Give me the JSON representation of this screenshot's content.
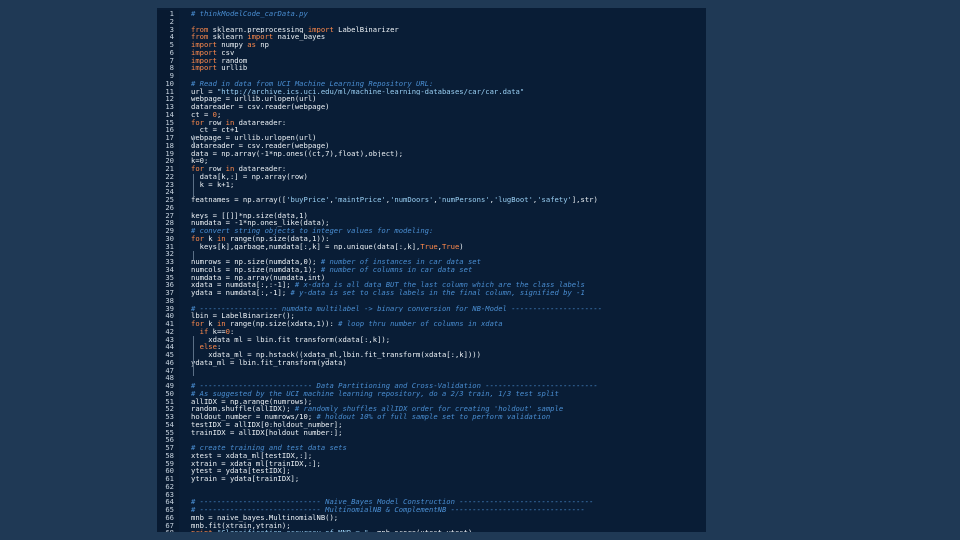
{
  "editor": {
    "colors": {
      "page": "#1f3955",
      "editor": "#091d36",
      "keyword": "#ff8a4c",
      "comment": "#4a8ed2",
      "string": "#9ad0f4",
      "default": "#eef3f7",
      "line_number": "#c7d3df"
    },
    "lines": [
      [
        {
          "t": "cm",
          "s": "# thinkModelCode_carData.py"
        }
      ],
      [],
      [
        {
          "t": "kw",
          "s": "from"
        },
        {
          "t": "df",
          "s": " sklearn.preprocessing "
        },
        {
          "t": "kw",
          "s": "import"
        },
        {
          "t": "df",
          "s": " LabelBinarizer"
        }
      ],
      [
        {
          "t": "kw",
          "s": "from"
        },
        {
          "t": "df",
          "s": " sklearn "
        },
        {
          "t": "kw",
          "s": "import"
        },
        {
          "t": "df",
          "s": " naive_bayes"
        }
      ],
      [
        {
          "t": "kw",
          "s": "import"
        },
        {
          "t": "df",
          "s": " numpy "
        },
        {
          "t": "kw",
          "s": "as"
        },
        {
          "t": "df",
          "s": " np"
        }
      ],
      [
        {
          "t": "kw",
          "s": "import"
        },
        {
          "t": "df",
          "s": " csv"
        }
      ],
      [
        {
          "t": "kw",
          "s": "import"
        },
        {
          "t": "df",
          "s": " random"
        }
      ],
      [
        {
          "t": "kw",
          "s": "import"
        },
        {
          "t": "df",
          "s": " urllib"
        }
      ],
      [],
      [
        {
          "t": "cm",
          "s": "# Read in data from UCI Machine Learning Repository URL:"
        }
      ],
      [
        {
          "t": "df",
          "s": "url = "
        },
        {
          "t": "st",
          "s": "\"http://archive.ics.uci.edu/ml/machine-learning-databases/car/car.data\""
        }
      ],
      [
        {
          "t": "df",
          "s": "webpage = urllib.urlopen(url)"
        }
      ],
      [
        {
          "t": "df",
          "s": "datareader = csv.reader(webpage)"
        }
      ],
      [
        {
          "t": "df",
          "s": "ct = "
        },
        {
          "t": "kw",
          "s": "0"
        },
        {
          "t": "df",
          "s": ";"
        }
      ],
      [
        {
          "t": "kw",
          "s": "for"
        },
        {
          "t": "df",
          "s": " row "
        },
        {
          "t": "kw",
          "s": "in"
        },
        {
          "t": "df",
          "s": " datareader:"
        }
      ],
      [
        {
          "t": "df",
          "s": "  ct = ct+1"
        }
      ],
      [
        {
          "t": "df",
          "s": "webpage = urllib.urlopen(url)"
        }
      ],
      [
        {
          "t": "df",
          "s": "datareader = csv.reader(webpage)"
        }
      ],
      [
        {
          "t": "df",
          "s": "data = np.array(-1*np.ones((ct,7),float),object);"
        }
      ],
      [
        {
          "t": "df",
          "s": "k=0;"
        }
      ],
      [
        {
          "t": "kw",
          "s": "for"
        },
        {
          "t": "df",
          "s": " row "
        },
        {
          "t": "kw",
          "s": "in"
        },
        {
          "t": "df",
          "s": " datareader:"
        }
      ],
      [
        {
          "t": "df",
          "s": "  data[k,:] = np.array(row)"
        }
      ],
      [
        {
          "t": "df",
          "s": "  k = k+1;"
        }
      ],
      [],
      [
        {
          "t": "df",
          "s": "featnames = np.array(["
        },
        {
          "t": "st",
          "s": "'buyPrice'"
        },
        {
          "t": "df",
          "s": ","
        },
        {
          "t": "st",
          "s": "'maintPrice'"
        },
        {
          "t": "df",
          "s": ","
        },
        {
          "t": "st",
          "s": "'numDoors'"
        },
        {
          "t": "df",
          "s": ","
        },
        {
          "t": "st",
          "s": "'numPersons'"
        },
        {
          "t": "df",
          "s": ","
        },
        {
          "t": "st",
          "s": "'lugBoot'"
        },
        {
          "t": "df",
          "s": ","
        },
        {
          "t": "st",
          "s": "'safety'"
        },
        {
          "t": "df",
          "s": "],str)"
        }
      ],
      [],
      [
        {
          "t": "df",
          "s": "keys = [[]]*np.size(data,1)"
        }
      ],
      [
        {
          "t": "df",
          "s": "numdata = -1*np.ones_like(data);"
        }
      ],
      [
        {
          "t": "cm",
          "s": "# convert string objects to integer values for modeling:"
        }
      ],
      [
        {
          "t": "kw",
          "s": "for"
        },
        {
          "t": "df",
          "s": " k "
        },
        {
          "t": "kw",
          "s": "in"
        },
        {
          "t": "df",
          "s": " range(np.size(data,1)):"
        }
      ],
      [
        {
          "t": "df",
          "s": "  keys[k],garbage,numdata[:,k] = np.unique(data[:,k],"
        },
        {
          "t": "kw",
          "s": "True"
        },
        {
          "t": "df",
          "s": ","
        },
        {
          "t": "kw",
          "s": "True"
        },
        {
          "t": "df",
          "s": ")"
        }
      ],
      [],
      [
        {
          "t": "df",
          "s": "numrows = np.size(numdata,0); "
        },
        {
          "t": "cm",
          "s": "# number of instances in car data set"
        }
      ],
      [
        {
          "t": "df",
          "s": "numcols = np.size(numdata,1); "
        },
        {
          "t": "cm",
          "s": "# number of columns in car data set"
        }
      ],
      [
        {
          "t": "df",
          "s": "numdata = np.array(numdata,int)"
        }
      ],
      [
        {
          "t": "df",
          "s": "xdata = numdata[:,:-1]; "
        },
        {
          "t": "cm",
          "s": "# x-data is all data BUT the last column which are the class labels"
        }
      ],
      [
        {
          "t": "df",
          "s": "ydata = numdata[:,-1]; "
        },
        {
          "t": "cm",
          "s": "# y-data is set to class labels in the final column, signified by -1"
        }
      ],
      [],
      [
        {
          "t": "cm",
          "s": "# ------------------ numdata multilabel -> binary conversion for NB-Model ---------------------"
        }
      ],
      [
        {
          "t": "df",
          "s": "lbin = LabelBinarizer();"
        }
      ],
      [
        {
          "t": "kw",
          "s": "for"
        },
        {
          "t": "df",
          "s": " k "
        },
        {
          "t": "kw",
          "s": "in"
        },
        {
          "t": "df",
          "s": " range(np.size(xdata,1)): "
        },
        {
          "t": "cm",
          "s": "# loop thru number of columns in xdata"
        }
      ],
      [
        {
          "t": "df",
          "s": "  "
        },
        {
          "t": "kw",
          "s": "if"
        },
        {
          "t": "df",
          "s": " k=="
        },
        {
          "t": "kw",
          "s": "0"
        },
        {
          "t": "df",
          "s": ":"
        }
      ],
      [
        {
          "t": "df",
          "s": "    xdata_ml = lbin.fit_transform(xdata[:,k]);"
        }
      ],
      [
        {
          "t": "df",
          "s": "  "
        },
        {
          "t": "kw",
          "s": "else"
        },
        {
          "t": "df",
          "s": ":"
        }
      ],
      [
        {
          "t": "df",
          "s": "    xdata_ml = np.hstack((xdata_ml,lbin.fit_transform(xdata[:,k])))"
        }
      ],
      [
        {
          "t": "df",
          "s": "ydata_ml = lbin.fit_transform(ydata)"
        }
      ],
      [],
      [],
      [
        {
          "t": "cm",
          "s": "# -------------------------- Data Partitioning and Cross-Validation --------------------------"
        }
      ],
      [
        {
          "t": "cm",
          "s": "# As suggested by the UCI machine learning repository, do a 2/3 train, 1/3 test split"
        }
      ],
      [
        {
          "t": "df",
          "s": "allIDX = np.arange(numrows);"
        }
      ],
      [
        {
          "t": "df",
          "s": "random.shuffle(allIDX); "
        },
        {
          "t": "cm",
          "s": "# randomly shuffles allIDX order for creating 'holdout' sample"
        }
      ],
      [
        {
          "t": "df",
          "s": "holdout_number = numrows/10; "
        },
        {
          "t": "cm",
          "s": "# holdout 10% of full sample set to perform validation"
        }
      ],
      [
        {
          "t": "df",
          "s": "testIDX = allIDX[0:holdout_number];"
        }
      ],
      [
        {
          "t": "df",
          "s": "trainIDX = allIDX[holdout_number:];"
        }
      ],
      [],
      [
        {
          "t": "cm",
          "s": "# create training and test data sets"
        }
      ],
      [
        {
          "t": "df",
          "s": "xtest = xdata_ml[testIDX,:];"
        }
      ],
      [
        {
          "t": "df",
          "s": "xtrain = xdata_ml[trainIDX,:];"
        }
      ],
      [
        {
          "t": "df",
          "s": "ytest = ydata[testIDX];"
        }
      ],
      [
        {
          "t": "df",
          "s": "ytrain = ydata[trainIDX];"
        }
      ],
      [],
      [],
      [
        {
          "t": "cm",
          "s": "# ---------------------------- Naive_Bayes Model Construction -------------------------------"
        }
      ],
      [
        {
          "t": "cm",
          "s": "# ---------------------------- MultinomialNB & ComplementNB -------------------------------"
        }
      ],
      [
        {
          "t": "df",
          "s": "mnb = naive_bayes.MultinomialNB();"
        }
      ],
      [
        {
          "t": "df",
          "s": "mnb.fit(xtrain,ytrain);"
        }
      ],
      [
        {
          "t": "kw",
          "s": "print"
        },
        {
          "t": "df",
          "s": " "
        },
        {
          "t": "st",
          "s": "\"Classification accuracy of MNB = \""
        },
        {
          "t": "df",
          "s": ", mnb.score(xtest,ytest)"
        }
      ]
    ]
  }
}
